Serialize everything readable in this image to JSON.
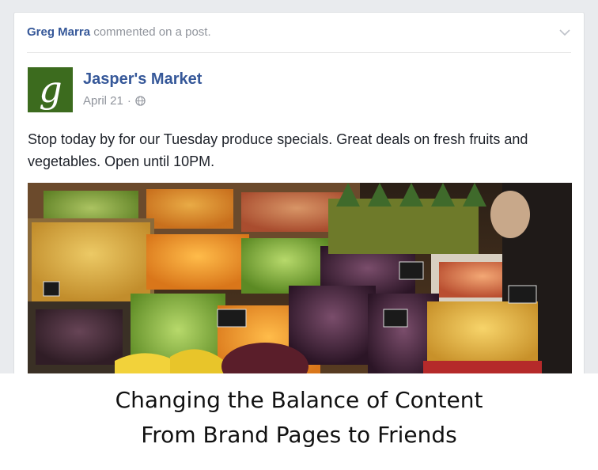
{
  "story": {
    "actor": "Greg Marra",
    "action": "commented on a post."
  },
  "post": {
    "page_name": "Jasper's Market",
    "logo_letter": "g",
    "date": "April 21",
    "separator": "·",
    "audience_icon": "globe-icon",
    "text": "Stop today by for our Tuesday produce specials. Great deals on fresh fruits and vegetables. Open until 10PM.",
    "photo_subject": ""
  },
  "menu": {
    "icon": "chevron-down-icon"
  },
  "caption": {
    "line1": "Changing the Balance of Content",
    "line2": "From Brand Pages to Friends"
  },
  "colors": {
    "link": "#365899",
    "meta": "#90949c",
    "text": "#1d2129",
    "logo_bg": "#3c6b1e"
  }
}
